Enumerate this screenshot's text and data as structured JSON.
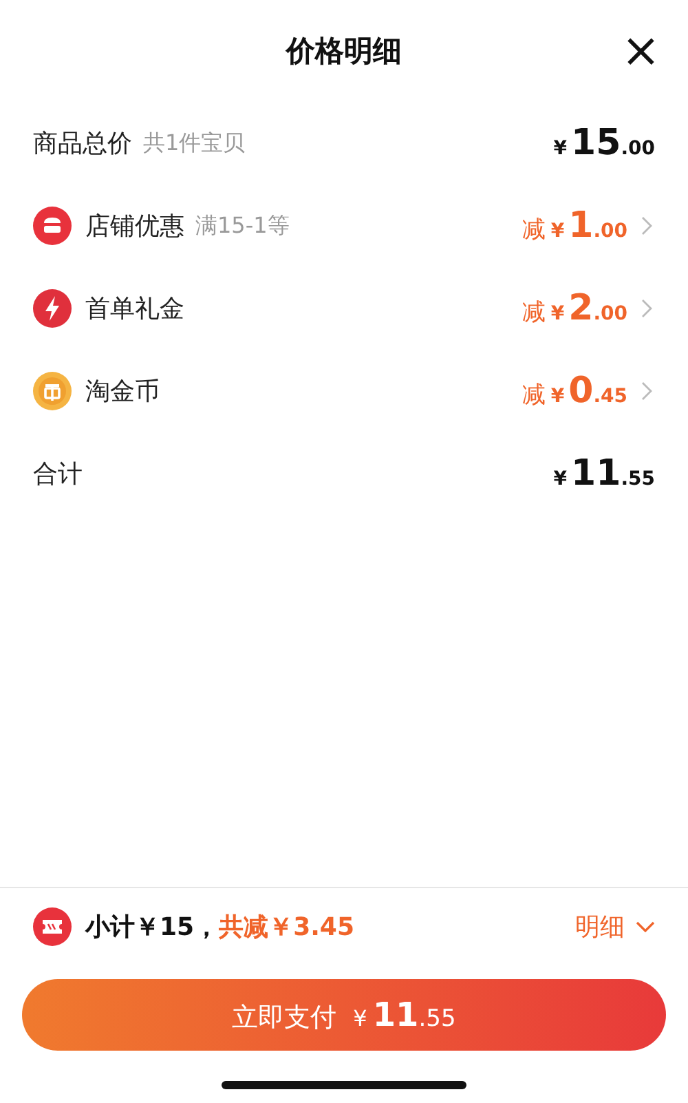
{
  "header": {
    "title": "价格明细",
    "close": "×"
  },
  "rows": [
    {
      "kind": "plain",
      "label": "商品总价",
      "note": "共1件宝贝",
      "discount": false,
      "prefix": "",
      "currency": "¥",
      "integer": "15",
      "decimal": ".00",
      "chevron": false
    },
    {
      "kind": "shop",
      "label": "店铺优惠",
      "note": "满15-1等",
      "discount": true,
      "prefix": "减",
      "currency": "¥",
      "integer": "1",
      "decimal": ".00",
      "chevron": true
    },
    {
      "kind": "bolt",
      "label": "首单礼金",
      "note": "",
      "discount": true,
      "prefix": "减",
      "currency": "¥",
      "integer": "2",
      "decimal": ".00",
      "chevron": true
    },
    {
      "kind": "coin",
      "label": "淘金币",
      "note": "",
      "discount": true,
      "prefix": "减",
      "currency": "¥",
      "integer": "0",
      "decimal": ".45",
      "chevron": true
    },
    {
      "kind": "plain",
      "label": "合计",
      "note": "",
      "discount": false,
      "prefix": "",
      "currency": "¥",
      "integer": "11",
      "decimal": ".55",
      "chevron": false
    }
  ],
  "footer": {
    "subtotal": "小计￥15，",
    "saving": "共减￥3.45",
    "details": "明细",
    "expanded": false,
    "pay_button": {
      "label": "立即支付",
      "currency": "¥",
      "integer": "11",
      "decimal": ".55"
    }
  }
}
